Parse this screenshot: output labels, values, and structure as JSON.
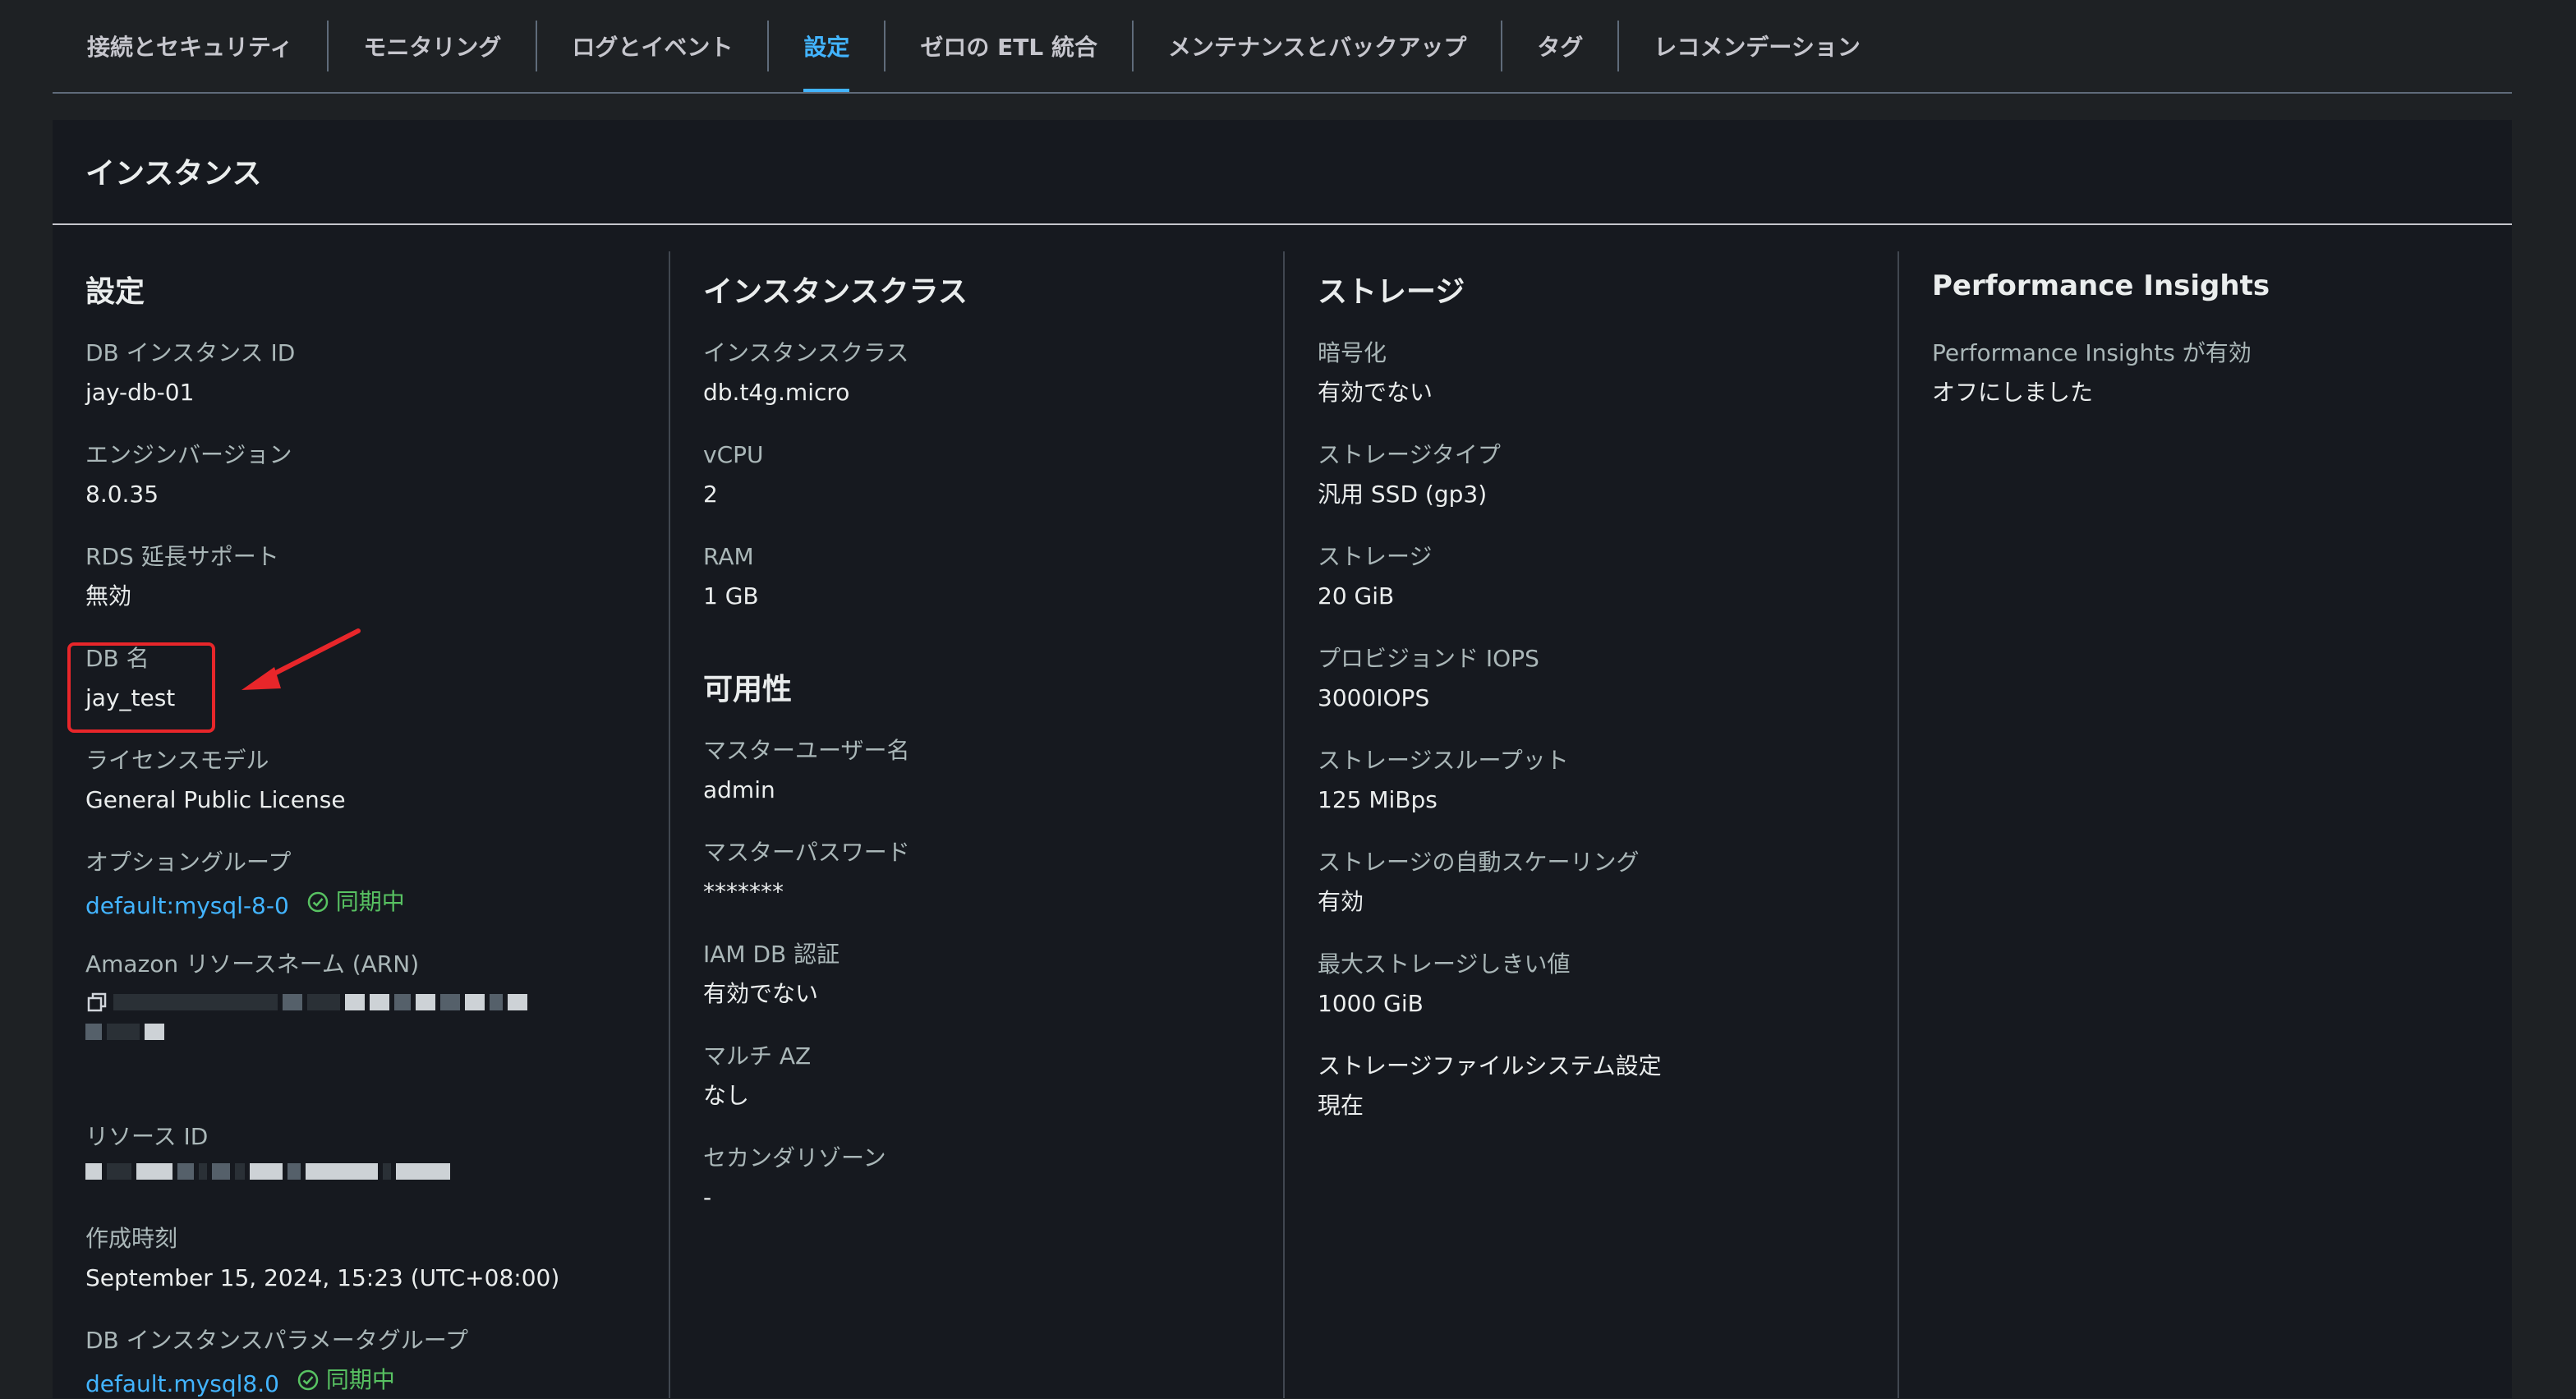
{
  "tabs": [
    {
      "label": "接続とセキュリティ",
      "active": false
    },
    {
      "label": "モニタリング",
      "active": false
    },
    {
      "label": "ログとイベント",
      "active": false
    },
    {
      "label": "設定",
      "active": true
    },
    {
      "label": "ゼロの ETL 統合",
      "active": false
    },
    {
      "label": "メンテナンスとバックアップ",
      "active": false
    },
    {
      "label": "タグ",
      "active": false
    },
    {
      "label": "レコメンデーション",
      "active": false
    }
  ],
  "panel": {
    "title": "インスタンス"
  },
  "config": {
    "title": "設定",
    "db_instance_id": {
      "label": "DB インスタンス ID",
      "value": "jay-db-01"
    },
    "engine_version": {
      "label": "エンジンバージョン",
      "value": "8.0.35"
    },
    "rds_extended_support": {
      "label": "RDS 延長サポート",
      "value": "無効"
    },
    "db_name": {
      "label": "DB 名",
      "value": "jay_test"
    },
    "license_model": {
      "label": "ライセンスモデル",
      "value": "General Public License"
    },
    "option_group": {
      "label": "オプショングループ",
      "value": "default:mysql-8-0",
      "status": "同期中"
    },
    "arn": {
      "label": "Amazon リソースネーム (ARN)"
    },
    "resource_id": {
      "label": "リソース ID"
    },
    "created_time": {
      "label": "作成時刻",
      "value": "September 15, 2024, 15:23 (UTC+08:00)"
    },
    "parameter_group": {
      "label": "DB インスタンスパラメータグループ",
      "value": "default.mysql8.0",
      "status": "同期中"
    }
  },
  "instance_class": {
    "title": "インスタンスクラス",
    "class": {
      "label": "インスタンスクラス",
      "value": "db.t4g.micro"
    },
    "vcpu": {
      "label": "vCPU",
      "value": "2"
    },
    "ram": {
      "label": "RAM",
      "value": "1 GB"
    }
  },
  "availability": {
    "title": "可用性",
    "master_user": {
      "label": "マスターユーザー名",
      "value": "admin"
    },
    "master_password": {
      "label": "マスターパスワード",
      "value": "*******"
    },
    "iam_auth": {
      "label": "IAM DB 認証",
      "value": "有効でない"
    },
    "multi_az": {
      "label": "マルチ AZ",
      "value": "なし"
    },
    "secondary_zone": {
      "label": "セカンダリゾーン",
      "value": "-"
    }
  },
  "storage": {
    "title": "ストレージ",
    "encryption": {
      "label": "暗号化",
      "value": "有効でない"
    },
    "storage_type": {
      "label": "ストレージタイプ",
      "value": "汎用 SSD (gp3)"
    },
    "storage": {
      "label": "ストレージ",
      "value": "20 GiB"
    },
    "iops": {
      "label": "プロビジョンド IOPS",
      "value": "3000IOPS"
    },
    "throughput": {
      "label": "ストレージスループット",
      "value": "125 MiBps"
    },
    "autoscaling": {
      "label": "ストレージの自動スケーリング",
      "value": "有効"
    },
    "max_threshold": {
      "label": "最大ストレージしきい値",
      "value": "1000 GiB"
    },
    "filesystem": {
      "label": "ストレージファイルシステム設定",
      "value": "現在"
    }
  },
  "performance_insights": {
    "title": "Performance Insights",
    "enabled": {
      "label": "Performance Insights が有効",
      "value": "オフにしました"
    }
  },
  "colors": {
    "accent": "#42b4ff",
    "success": "#58c262",
    "annotation": "#e8262a"
  }
}
